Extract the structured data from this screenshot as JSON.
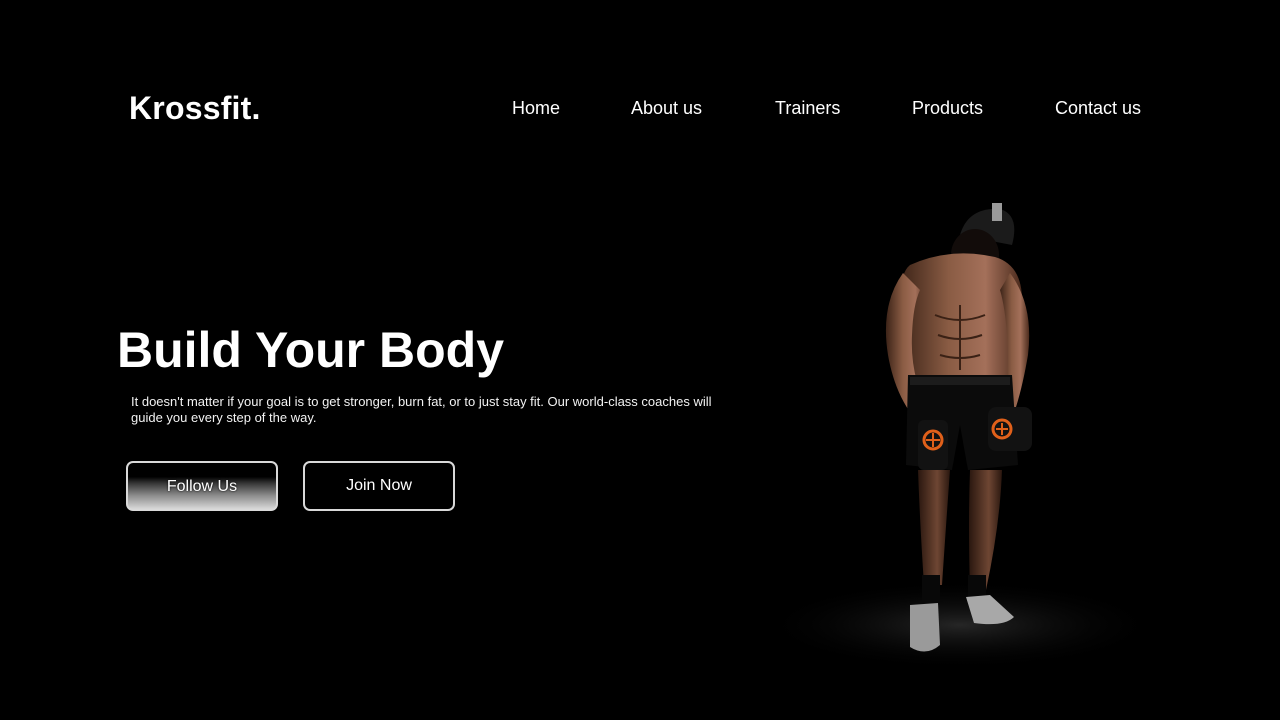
{
  "brand": {
    "logo": "Krossfit."
  },
  "nav": {
    "items": [
      {
        "label": "Home"
      },
      {
        "label": "About us"
      },
      {
        "label": "Trainers"
      },
      {
        "label": "Products"
      },
      {
        "label": "Contact us"
      }
    ]
  },
  "hero": {
    "title": "Build Your Body",
    "description": "It doesn't matter if your goal is to get stronger, burn fat, or to just stay fit. Our world-class coaches will guide you every step of the way.",
    "primary_button": "Follow Us",
    "secondary_button": "Join Now"
  },
  "image": {
    "subject": "athlete-with-dumbbells"
  },
  "colors": {
    "background": "#000000",
    "text": "#ffffff",
    "accent": "#e0601a"
  }
}
